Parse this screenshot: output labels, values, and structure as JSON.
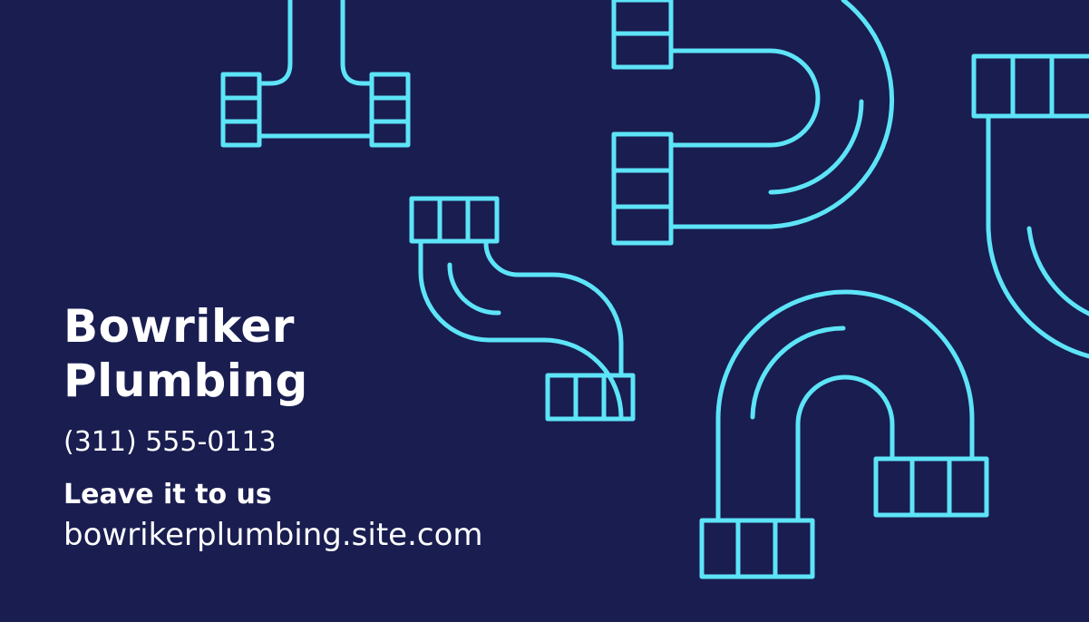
{
  "company": {
    "name_line1": "Bowriker",
    "name_line2": "Plumbing",
    "phone": "(311) 555-0113",
    "tagline": "Leave it to us",
    "website": "bowrikerplumbing.site.com"
  },
  "colors": {
    "background": "#191d50",
    "pipe_stroke": "#5de4f7",
    "text": "#ffffff"
  },
  "icons": [
    "t-pipe-icon",
    "u-bend-pipe-icon",
    "s-bend-pipe-icon",
    "j-bend-pipe-icon",
    "elbow-pipe-icon"
  ]
}
